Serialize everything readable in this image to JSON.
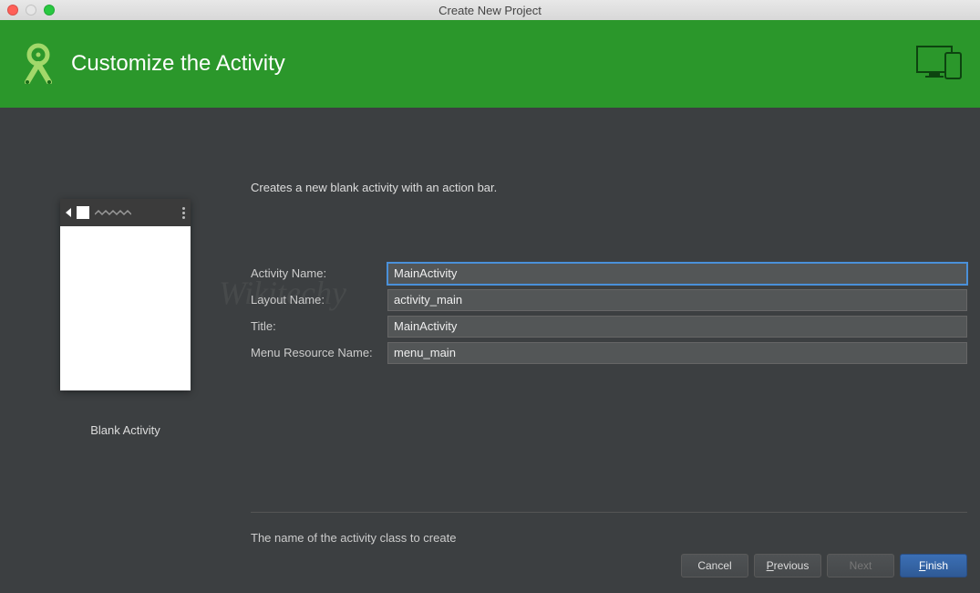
{
  "window": {
    "title": "Create New Project"
  },
  "banner": {
    "title": "Customize the Activity"
  },
  "thumb": {
    "label": "Blank Activity"
  },
  "description": "Creates a new blank activity with an action bar.",
  "form": {
    "labels": {
      "activity_name": "Activity Name:",
      "layout_name": "Layout Name:",
      "title": "Title:",
      "menu_resource_name": "Menu Resource Name:"
    },
    "values": {
      "activity_name": "MainActivity",
      "layout_name": "activity_main",
      "title": "MainActivity",
      "menu_resource_name": "menu_main"
    }
  },
  "hint": "The name of the activity class to create",
  "buttons": {
    "cancel": "Cancel",
    "previous": "Previous",
    "next": "Next",
    "finish": "Finish"
  },
  "watermark": "Wikitechy"
}
